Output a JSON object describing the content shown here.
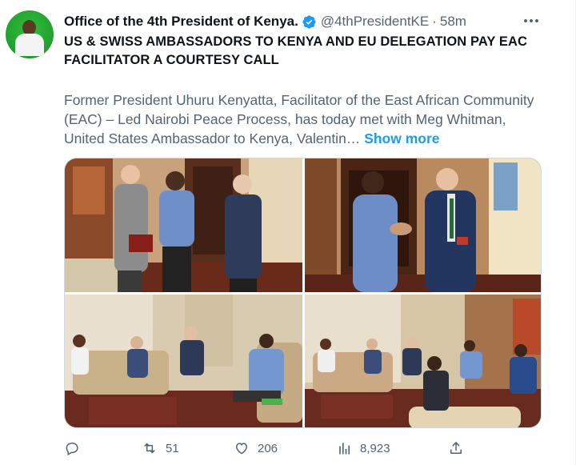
{
  "author": {
    "display_name": "Office of the 4th President of Kenya.",
    "handle": "@4thPresidentKE",
    "separator": "·",
    "time": "58m",
    "verified": true,
    "avatar_color": "#23a32f"
  },
  "tweet": {
    "headline": "US & SWISS AMBASSADORS TO KENYA AND EU DELEGATION PAY EAC FACILITATOR A COURTESY CALL",
    "body": "Former President Uhuru Kenyatta, Facilitator of the East African Community (EAC) – Led Nairobi Peace Process, has today met with Meg Whitman, United States Ambassador to Kenya, Valentin…",
    "show_more": "Show more"
  },
  "media": {
    "photos": [
      "meeting-photo-1",
      "meeting-photo-2",
      "meeting-photo-3",
      "meeting-photo-4"
    ]
  },
  "actions": {
    "reply": {
      "icon": "reply-icon",
      "count": ""
    },
    "retweet": {
      "icon": "retweet-icon",
      "count": "51"
    },
    "like": {
      "icon": "heart-icon",
      "count": "206"
    },
    "views": {
      "icon": "views-icon",
      "count": "8,923"
    },
    "share": {
      "icon": "share-icon"
    }
  },
  "colors": {
    "text_primary": "#0f1419",
    "text_secondary": "#536471",
    "link": "#1d9bf0",
    "verified": "#1d9bf0"
  }
}
